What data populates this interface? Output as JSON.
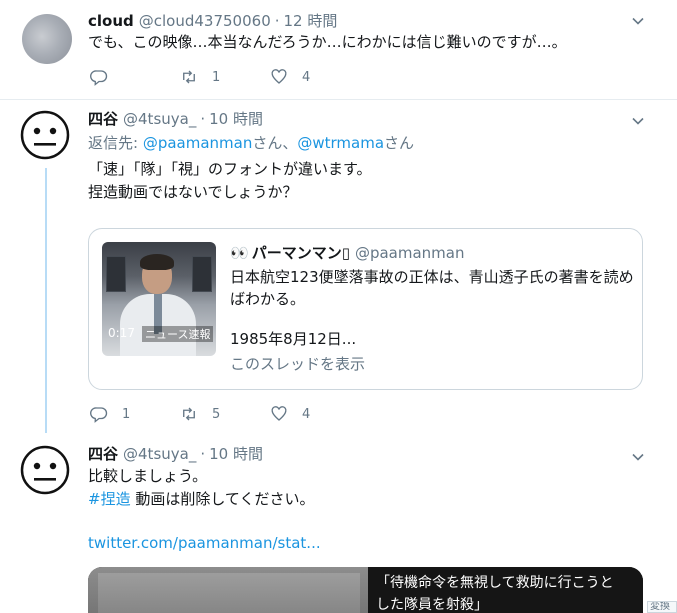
{
  "tweets": [
    {
      "name": "cloud",
      "handle": "@cloud43750060",
      "time": "12 時間",
      "text": "でも、この映像…本当なんだろうか…にわかには信じ難いのですが…。",
      "actions": {
        "reply": "",
        "retweet": "1",
        "like": "4"
      }
    },
    {
      "name": "四谷",
      "handle": "@4tsuya_",
      "time": "10 時間",
      "reply_prefix": "返信先: ",
      "reply_mention1": "@paamanman",
      "reply_san1": "さん、",
      "reply_mention2": "@wtrmama",
      "reply_san2": "さん",
      "line1": "「速」「隊」「視」のフォントが違います。",
      "line2": "捏造動画ではないでしょうか？",
      "quote": {
        "eyes": "👀",
        "name": "パーマンマン",
        "name_suffix": "▯",
        "handle": "@paamanman",
        "text": "日本航空123便墜落事故の正体は、青山透子氏の著書を読めばわかる。",
        "date": "1985年8月12日...",
        "thread_link": "このスレッドを表示",
        "thumb_duration": "0:17",
        "thumb_caption": "ニュース速報"
      },
      "actions": {
        "reply": "1",
        "retweet": "5",
        "like": "4"
      }
    },
    {
      "name": "四谷",
      "handle": "@4tsuya_",
      "time": "10 時間",
      "line1": "比較しましょう。",
      "hashtag": "#捏造",
      "line2_rest": " 動画は削除してください。",
      "url": "twitter.com/paamanman/stat...",
      "media_line1": "「待機命令を無視して救助に行こうと",
      "media_line2": "した隊員を射殺」",
      "corner_badge": "変換"
    }
  ],
  "separator": "·"
}
